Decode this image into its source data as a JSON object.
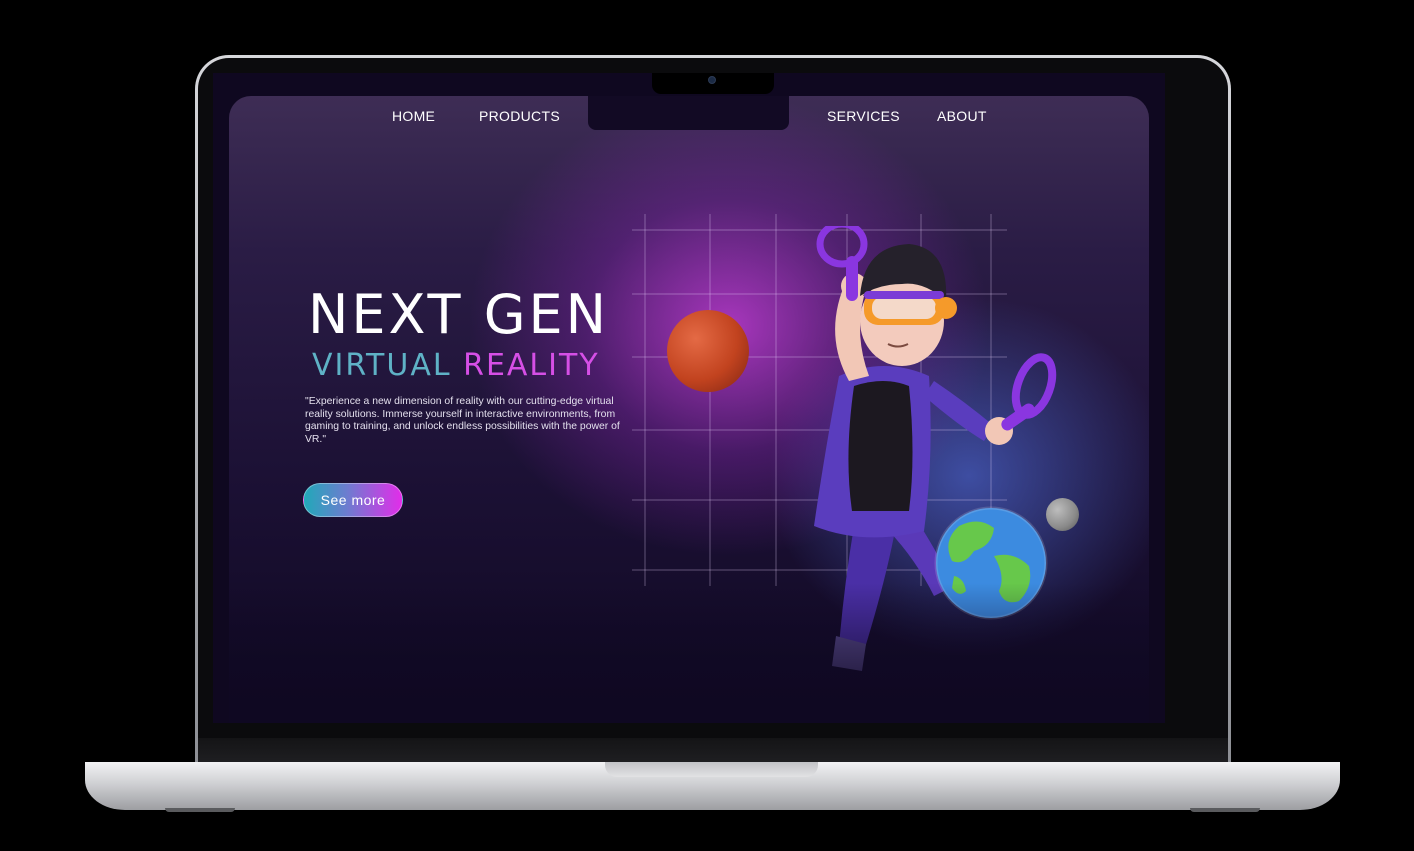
{
  "nav": {
    "items": [
      "HOME",
      "PRODUCTS",
      "SERVICES",
      "ABOUT"
    ]
  },
  "hero": {
    "headline": "NEXT GEN",
    "subline_part1": "VIRTUAL",
    "subline_part2": "REALITY",
    "description": "\"Experience a new dimension of reality with our cutting-edge virtual reality solutions. Immerse yourself in interactive environments, from gaming to training, and unlock endless possibilities with the power of VR.\"",
    "cta_label": "See more"
  },
  "colors": {
    "accent_teal": "#5fb2c6",
    "accent_magenta": "#d64fe6",
    "background_dark": "#1c1135"
  },
  "illustration": {
    "character": "vr-character-illustration",
    "planets": [
      "red-planet-icon",
      "earth-globe-icon",
      "asteroid-icon"
    ]
  }
}
